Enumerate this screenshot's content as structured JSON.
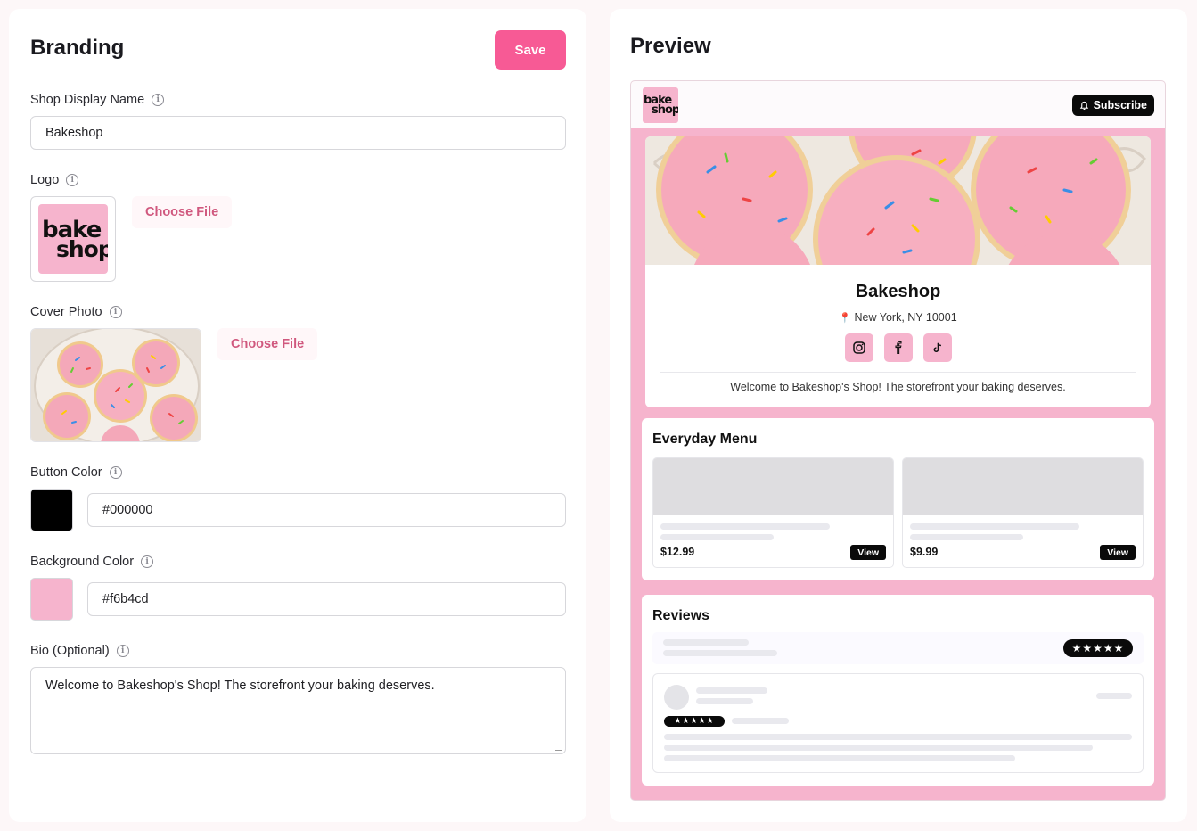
{
  "branding": {
    "title": "Branding",
    "save_label": "Save",
    "fields": {
      "shop_name_label": "Shop Display Name",
      "shop_name_value": "Bakeshop",
      "logo_label": "Logo",
      "logo_choose": "Choose File",
      "cover_label": "Cover Photo",
      "cover_choose": "Choose File",
      "button_color_label": "Button Color",
      "button_color_value": "#000000",
      "bg_color_label": "Background Color",
      "bg_color_value": "#f6b4cd",
      "bio_label": "Bio (Optional)",
      "bio_value": "Welcome to Bakeshop's Shop! The storefront your baking deserves."
    },
    "logo_text": {
      "line1": "bake",
      "line2": "shop"
    }
  },
  "colors": {
    "accent": "#f75a95",
    "button": "#000000",
    "background": "#f6b4cd"
  },
  "preview": {
    "title": "Preview",
    "subscribe_label": "Subscribe",
    "shop_name": "Bakeshop",
    "location": "New York, NY 10001",
    "bio": "Welcome to Bakeshop's Shop! The storefront your baking deserves.",
    "social_icons": [
      "instagram-icon",
      "facebook-icon",
      "tiktok-icon"
    ],
    "menu": {
      "title": "Everyday Menu",
      "products": [
        {
          "price": "$12.99",
          "action": "View"
        },
        {
          "price": "$9.99",
          "action": "View"
        }
      ]
    },
    "reviews": {
      "title": "Reviews",
      "summary_stars": "★★★★★",
      "item_stars": "★★★★★",
      "rating": 5
    }
  }
}
